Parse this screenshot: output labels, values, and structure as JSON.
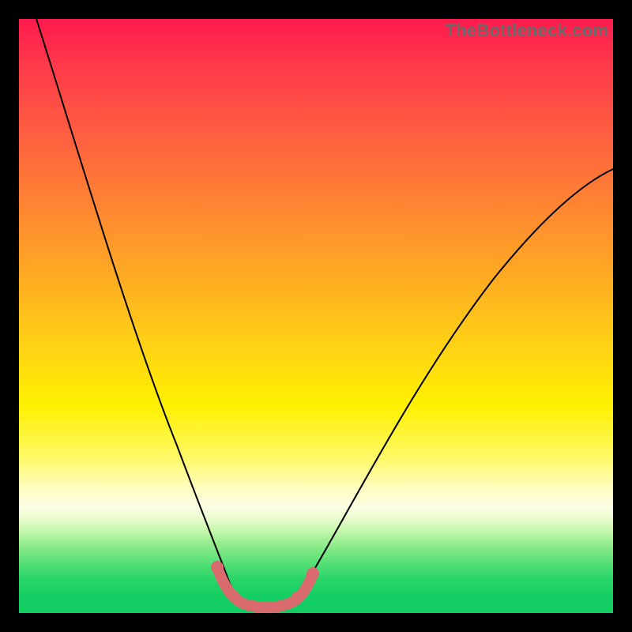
{
  "watermark": "TheBottleneck.com",
  "chart_data": {
    "type": "line",
    "title": "",
    "xlabel": "",
    "ylabel": "",
    "xlim": [
      0,
      100
    ],
    "ylim": [
      0,
      100
    ],
    "grid": false,
    "series": [
      {
        "name": "left-branch",
        "x": [
          3,
          10,
          18,
          24,
          28,
          32,
          35
        ],
        "y": [
          100,
          78,
          53,
          33,
          20,
          8,
          2
        ]
      },
      {
        "name": "right-branch",
        "x": [
          47,
          55,
          64,
          74,
          84,
          94,
          100
        ],
        "y": [
          2,
          10,
          24,
          40,
          55,
          68,
          74
        ]
      },
      {
        "name": "valley-floor",
        "x": [
          33,
          36,
          38,
          40,
          42,
          44,
          46,
          48
        ],
        "y": [
          4,
          1,
          0,
          0,
          0,
          0,
          1,
          4
        ]
      }
    ],
    "highlight": {
      "name": "bottleneck-region",
      "color": "#d96a6e",
      "x_range": [
        33,
        48
      ]
    },
    "background_gradient": {
      "top": "#ff1a4d",
      "mid": "#fff000",
      "bottom": "#10cd61"
    }
  }
}
